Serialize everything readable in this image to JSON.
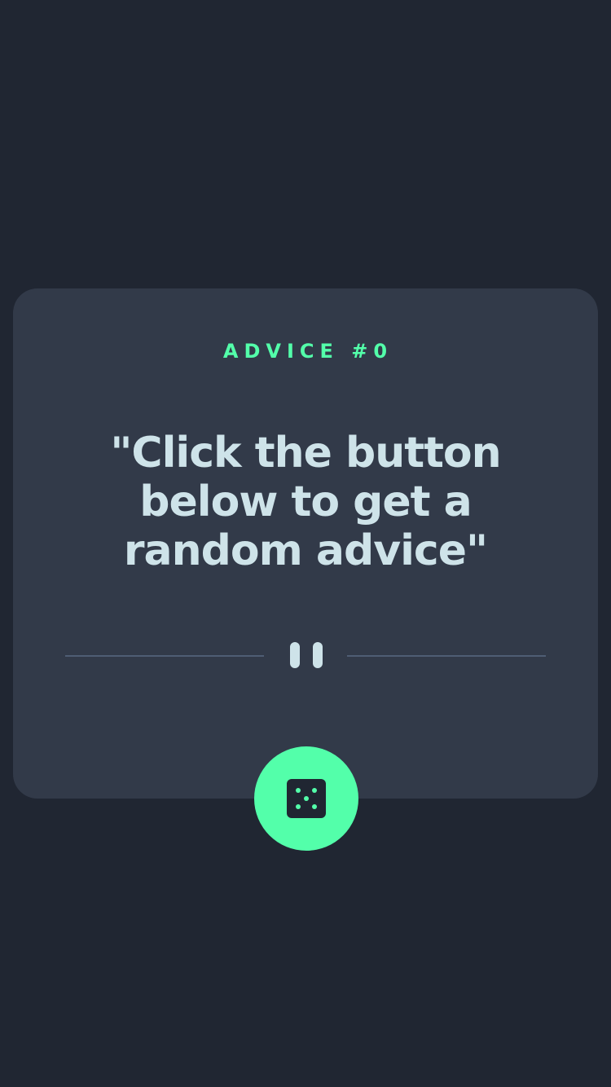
{
  "advice": {
    "id_label": "ADVICE #0",
    "text": "\"Click the button below to get a random advice\""
  },
  "divider": {
    "icon": "pause-icon"
  },
  "action": {
    "icon": "dice-icon",
    "button_name": "dice-button"
  },
  "colors": {
    "background": "#202632",
    "card": "#323a49",
    "accent": "#53ffaa",
    "text": "#cee3e9",
    "divider": "#4f5d74"
  }
}
